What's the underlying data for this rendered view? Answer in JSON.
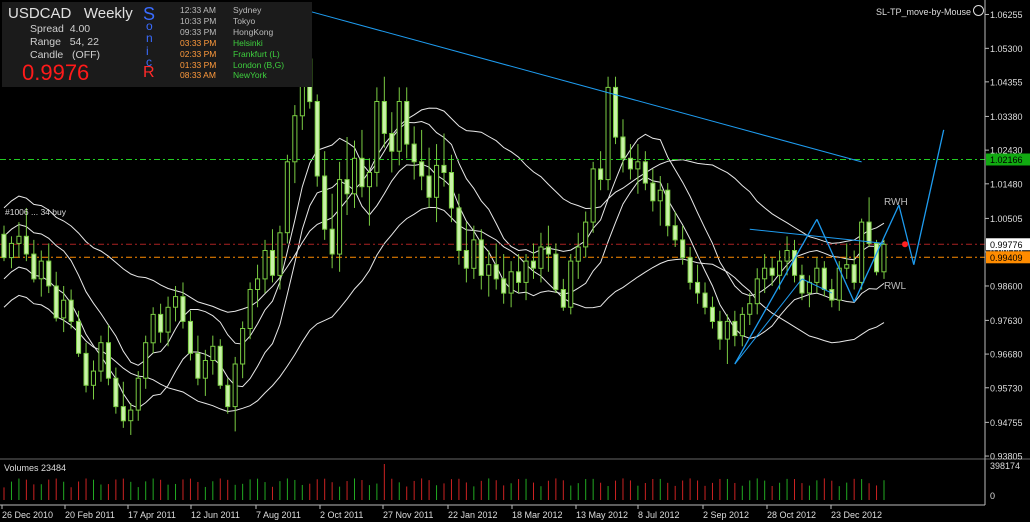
{
  "panel": {
    "symbol": "USDCAD",
    "timeframe": "Weekly",
    "spread_label": "Spread",
    "spread_value": "4.00",
    "range_label": "Range",
    "range_value": "54, 22",
    "candle_label": "Candle",
    "candle_value": "(OFF)",
    "bid": "0.9976",
    "sonic_letters": [
      "S",
      "o",
      "n",
      "i",
      "c",
      "R"
    ],
    "colors": {
      "bid": "#ff1a1a",
      "sonic_blue": "#3a6cff",
      "sonic_red": "#ff2a2a"
    }
  },
  "sessions": [
    {
      "time": "12:33 AM",
      "city": "Sydney",
      "time_color": "#bbbbbb",
      "city_color": "#bbbbbb"
    },
    {
      "time": "10:33 PM",
      "city": "Tokyo",
      "time_color": "#bbbbbb",
      "city_color": "#bbbbbb"
    },
    {
      "time": "09:33 PM",
      "city": "HongKong",
      "time_color": "#bbbbbb",
      "city_color": "#bbbbbb"
    },
    {
      "time": "03:33 PM",
      "city": "Helsinki",
      "time_color": "#ff9a3c",
      "city_color": "#3ecf3e"
    },
    {
      "time": "02:33 PM",
      "city": "Frankfurt  (L)",
      "time_color": "#ff9a3c",
      "city_color": "#3ecf3e"
    },
    {
      "time": "01:33 PM",
      "city": "London  (B,G)",
      "time_color": "#ff9a3c",
      "city_color": "#3ecf3e"
    },
    {
      "time": "08:33 AM",
      "city": "NewYork",
      "time_color": "#ff9a3c",
      "city_color": "#3ecf3e"
    }
  ],
  "indicator_name": "SL-TP_move-by-Mouse",
  "volume_label": "Volumes 23484",
  "volume_axis": [
    "398174",
    "0"
  ],
  "trade_label": "#1006 ... 34 buy",
  "rwh_label": "RWH",
  "rwl_label": "RWL",
  "price_axis": [
    "1.06255",
    "1.05300",
    "1.04355",
    "1.03380",
    "1.02430",
    "1.01480",
    "1.00505",
    "0.99560",
    "0.98600",
    "0.97630",
    "0.96680",
    "0.95730",
    "0.94755",
    "0.93805"
  ],
  "price_tags": [
    {
      "text": "1.02166",
      "bg": "#11aa11",
      "fg": "#000000"
    },
    {
      "text": "0.99776",
      "bg": "#ffffff",
      "fg": "#000000"
    },
    {
      "text": "0.99409",
      "bg": "#ff8c00",
      "fg": "#000000"
    }
  ],
  "date_axis": [
    "26 Dec 2010",
    "20 Feb 2011",
    "17 Apr 2011",
    "12 Jun 2011",
    "7 Aug 2011",
    "2 Oct 2011",
    "27 Nov 2011",
    "22 Jan 2012",
    "18 Mar 2012",
    "13 May 2012",
    "8 Jul 2012",
    "2 Sep 2012",
    "28 Oct 2012",
    "23 Dec 2012"
  ],
  "chart_data": {
    "type": "candlestick",
    "symbol": "USDCAD",
    "timeframe": "Weekly",
    "ylim": [
      0.9375,
      1.0655
    ],
    "candles": [
      [
        1.00058,
        1.003,
        0.993,
        0.994
      ],
      [
        0.994,
        1.0,
        0.991,
        0.998
      ],
      [
        0.998,
        1.004,
        0.994,
        1.0
      ],
      [
        1.0,
        1.008,
        0.993,
        0.995
      ],
      [
        0.995,
        0.999,
        0.987,
        0.988
      ],
      [
        0.988,
        0.996,
        0.983,
        0.993
      ],
      [
        0.993,
        0.998,
        0.984,
        0.986
      ],
      [
        0.986,
        0.99,
        0.976,
        0.977
      ],
      [
        0.977,
        0.986,
        0.973,
        0.982
      ],
      [
        0.982,
        0.985,
        0.974,
        0.976
      ],
      [
        0.976,
        0.979,
        0.966,
        0.967
      ],
      [
        0.967,
        0.97,
        0.956,
        0.958
      ],
      [
        0.958,
        0.965,
        0.954,
        0.962
      ],
      [
        0.962,
        0.972,
        0.959,
        0.97
      ],
      [
        0.97,
        0.975,
        0.958,
        0.96
      ],
      [
        0.96,
        0.963,
        0.95,
        0.952
      ],
      [
        0.952,
        0.959,
        0.946,
        0.948
      ],
      [
        0.948,
        0.953,
        0.944,
        0.951
      ],
      [
        0.951,
        0.962,
        0.948,
        0.96
      ],
      [
        0.96,
        0.972,
        0.957,
        0.97
      ],
      [
        0.97,
        0.98,
        0.967,
        0.978
      ],
      [
        0.978,
        0.981,
        0.97,
        0.973
      ],
      [
        0.973,
        0.983,
        0.969,
        0.98
      ],
      [
        0.98,
        0.986,
        0.976,
        0.983
      ],
      [
        0.983,
        0.987,
        0.974,
        0.976
      ],
      [
        0.976,
        0.979,
        0.965,
        0.967
      ],
      [
        0.967,
        0.972,
        0.958,
        0.96
      ],
      [
        0.96,
        0.968,
        0.955,
        0.965
      ],
      [
        0.965,
        0.972,
        0.961,
        0.969
      ],
      [
        0.969,
        0.971,
        0.957,
        0.958
      ],
      [
        0.958,
        0.96,
        0.95,
        0.952
      ],
      [
        0.952,
        0.966,
        0.945,
        0.964
      ],
      [
        0.964,
        0.976,
        0.96,
        0.974
      ],
      [
        0.974,
        0.987,
        0.971,
        0.985
      ],
      [
        0.985,
        0.992,
        0.98,
        0.988
      ],
      [
        0.988,
        0.999,
        0.984,
        0.996
      ],
      [
        0.996,
        1.002,
        0.987,
        0.989
      ],
      [
        0.989,
        1.003,
        0.985,
        1.001
      ],
      [
        1.001,
        1.023,
        0.998,
        1.021
      ],
      [
        1.021,
        1.037,
        1.015,
        1.034
      ],
      [
        1.034,
        1.058,
        1.03,
        1.05
      ],
      [
        1.05,
        1.056,
        1.036,
        1.038
      ],
      [
        1.038,
        1.04,
        1.014,
        1.017
      ],
      [
        1.017,
        1.024,
        0.999,
        1.002
      ],
      [
        1.002,
        1.012,
        0.991,
        0.995
      ],
      [
        0.995,
        1.021,
        0.99,
        1.016
      ],
      [
        1.016,
        1.028,
        1.006,
        1.012
      ],
      [
        1.012,
        1.027,
        1.008,
        1.022
      ],
      [
        1.022,
        1.03,
        1.011,
        1.014
      ],
      [
        1.014,
        1.022,
        1.003,
        1.018
      ],
      [
        1.018,
        1.042,
        1.014,
        1.038
      ],
      [
        1.038,
        1.045,
        1.025,
        1.029
      ],
      [
        1.029,
        1.035,
        1.018,
        1.024
      ],
      [
        1.024,
        1.042,
        1.02,
        1.038
      ],
      [
        1.038,
        1.042,
        1.022,
        1.026
      ],
      [
        1.026,
        1.031,
        1.016,
        1.021
      ],
      [
        1.021,
        1.03,
        1.013,
        1.017
      ],
      [
        1.017,
        1.025,
        1.008,
        1.011
      ],
      [
        1.011,
        1.026,
        1.004,
        1.02
      ],
      [
        1.02,
        1.029,
        1.014,
        1.018
      ],
      [
        1.018,
        1.023,
        1.004,
        1.008
      ],
      [
        1.008,
        1.012,
        0.992,
        0.996
      ],
      [
        0.996,
        1.004,
        0.987,
        0.991
      ],
      [
        0.991,
        1.003,
        0.988,
        0.999
      ],
      [
        0.999,
        1.002,
        0.985,
        0.989
      ],
      [
        0.989,
        0.996,
        0.983,
        0.992
      ],
      [
        0.992,
        0.998,
        0.985,
        0.988
      ],
      [
        0.988,
        0.995,
        0.981,
        0.984
      ],
      [
        0.984,
        0.993,
        0.98,
        0.99
      ],
      [
        0.99,
        0.995,
        0.984,
        0.987
      ],
      [
        0.987,
        0.995,
        0.982,
        0.993
      ],
      [
        0.993,
        0.998,
        0.988,
        0.991
      ],
      [
        0.991,
        1.001,
        0.987,
        0.997
      ],
      [
        0.997,
        1.003,
        0.99,
        0.995
      ],
      [
        0.995,
        0.998,
        0.984,
        0.985
      ],
      [
        0.985,
        0.988,
        0.979,
        0.98
      ],
      [
        0.98,
        0.995,
        0.978,
        0.993
      ],
      [
        0.993,
        1.001,
        0.988,
        0.997
      ],
      [
        0.997,
        1.007,
        0.994,
        1.004
      ],
      [
        1.004,
        1.021,
        1.001,
        1.019
      ],
      [
        1.019,
        1.024,
        1.013,
        1.016
      ],
      [
        1.016,
        1.045,
        1.013,
        1.042
      ],
      [
        1.042,
        1.045,
        1.026,
        1.028
      ],
      [
        1.028,
        1.033,
        1.018,
        1.022
      ],
      [
        1.022,
        1.026,
        1.016,
        1.019
      ],
      [
        1.019,
        1.026,
        1.012,
        1.021
      ],
      [
        1.021,
        1.024,
        1.013,
        1.015
      ],
      [
        1.015,
        1.019,
        1.007,
        1.01
      ],
      [
        1.01,
        1.017,
        1.003,
        1.013
      ],
      [
        1.013,
        1.015,
        1.0,
        1.003
      ],
      [
        1.003,
        1.007,
        0.997,
        0.999
      ],
      [
        0.999,
        1.003,
        0.992,
        0.994
      ],
      [
        0.994,
        0.997,
        0.985,
        0.987
      ],
      [
        0.987,
        0.992,
        0.981,
        0.984
      ],
      [
        0.984,
        0.987,
        0.978,
        0.98
      ],
      [
        0.98,
        0.983,
        0.974,
        0.976
      ],
      [
        0.976,
        0.979,
        0.968,
        0.971
      ],
      [
        0.971,
        0.978,
        0.964,
        0.976
      ],
      [
        0.976,
        0.979,
        0.969,
        0.972
      ],
      [
        0.972,
        0.98,
        0.969,
        0.978
      ],
      [
        0.978,
        0.984,
        0.975,
        0.981
      ],
      [
        0.981,
        0.991,
        0.978,
        0.988
      ],
      [
        0.988,
        0.995,
        0.984,
        0.991
      ],
      [
        0.991,
        0.994,
        0.986,
        0.989
      ],
      [
        0.989,
        0.996,
        0.985,
        0.993
      ],
      [
        0.993,
        1.0,
        0.989,
        0.996
      ],
      [
        0.996,
        0.999,
        0.987,
        0.989
      ],
      [
        0.989,
        0.992,
        0.982,
        0.984
      ],
      [
        0.984,
        0.989,
        0.98,
        0.987
      ],
      [
        0.987,
        0.994,
        0.984,
        0.991
      ],
      [
        0.991,
        0.993,
        0.983,
        0.985
      ],
      [
        0.985,
        0.988,
        0.98,
        0.982
      ],
      [
        0.982,
        0.993,
        0.979,
        0.991
      ],
      [
        0.991,
        0.998,
        0.988,
        0.992
      ],
      [
        0.992,
        0.996,
        0.985,
        0.987
      ],
      [
        0.987,
        1.005,
        0.985,
        1.004
      ],
      [
        1.004,
        1.011,
        0.997,
        0.998
      ],
      [
        0.998,
        0.999,
        0.989,
        0.99
      ],
      [
        0.99,
        0.999,
        0.988,
        0.99776
      ]
    ],
    "indicators": [
      "moving averages (white)",
      "Volumes"
    ],
    "horizontal_lines": [
      1.02166,
      0.99776,
      0.99409
    ],
    "grid": false
  }
}
